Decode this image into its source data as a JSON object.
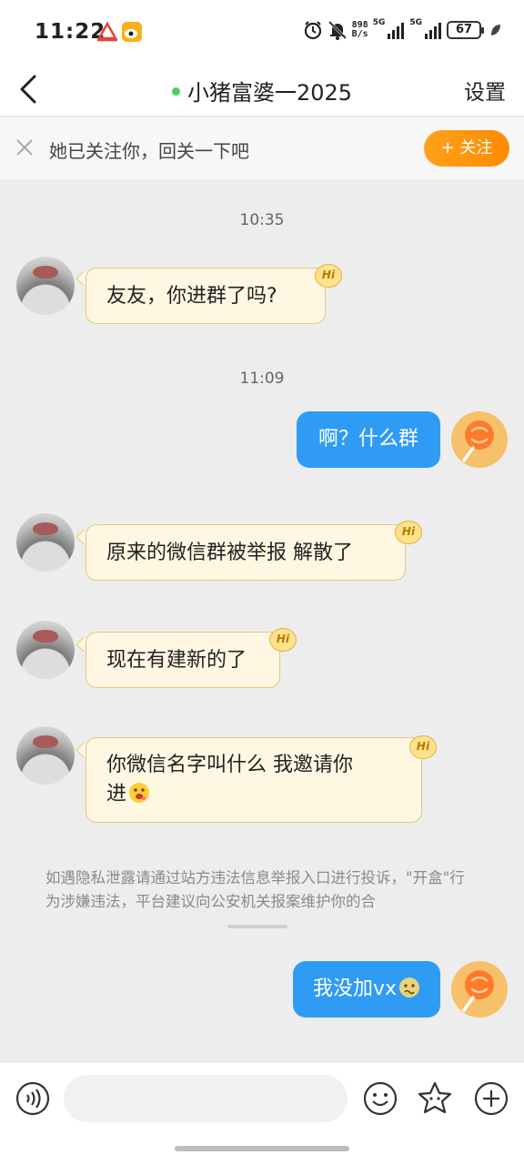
{
  "status_bar": {
    "time": "11:22",
    "net_speed_value": "898",
    "net_speed_unit": "B/s",
    "sig1_label": "5G",
    "sig2_label": "5G",
    "battery": "67"
  },
  "nav": {
    "title": "小猪富婆一2025",
    "settings": "设置"
  },
  "follow_bar": {
    "text": "她已关注你，回关一下吧",
    "button": "+ 关注"
  },
  "messages": {
    "ts1": "10:35",
    "m1": "友友，你进群了吗?",
    "ts2": "11:09",
    "m2": "啊？什么群",
    "m3": "原来的微信群被举报  解散了",
    "m4": "现在有建新的了",
    "m5_line1": "你微信名字叫什么    我邀请你",
    "m5_line2": "进",
    "m6": "我没加vx",
    "hi_badge": "Hi"
  },
  "notice": "如遇隐私泄露请通过站方违法信息举报入口进行投诉，\"开盒\"行为涉嫌违法，平台建议向公安机关报案维护你的合",
  "colors": {
    "accent_orange": "#ff9a10",
    "bubble_blue": "#2f9bf5",
    "bubble_cream": "#fff7e2",
    "online_green": "#4cd05e"
  }
}
